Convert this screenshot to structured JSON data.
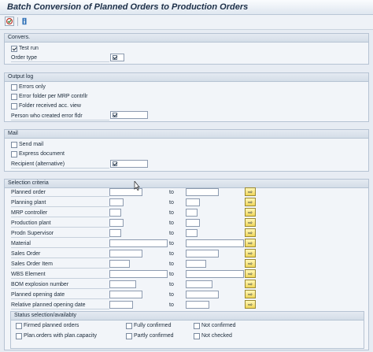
{
  "window": {
    "title": "Batch Conversion of Planned Orders to Production Orders"
  },
  "toolbar": {
    "buttons": [
      {
        "icon": "execute-icon"
      },
      {
        "icon": "info-icon"
      }
    ]
  },
  "conversion": {
    "title": "Convers.",
    "test_run_label": "Test run",
    "test_run_checked": true,
    "order_type_label": "Order type"
  },
  "output_log": {
    "title": "Output log",
    "errors_only_label": "Errors only",
    "error_folder_label": "Error folder per MRP contrllr",
    "folder_received_label": "Folder received acc. view",
    "person_created_label": "Person who created error fldr"
  },
  "mail": {
    "title": "Mail",
    "send_mail_label": "Send mail",
    "express_label": "Express document",
    "recipient_label": "Recipient (alternative)"
  },
  "selection": {
    "title": "Selection criteria",
    "to_label": "to",
    "rows": [
      {
        "label": "Planned order"
      },
      {
        "label": "Planning plant"
      },
      {
        "label": "MRP controller"
      },
      {
        "label": "Production plant"
      },
      {
        "label": "Prodn Supervisor"
      },
      {
        "label": "Material"
      },
      {
        "label": "Sales Order"
      },
      {
        "label": "Sales Order Item"
      },
      {
        "label": "WBS Element"
      },
      {
        "label": "BOM explosion number"
      },
      {
        "label": "Planned opening date"
      },
      {
        "label": "Relative planned opening date"
      }
    ]
  },
  "status": {
    "title": "Status selection/availabty",
    "options": [
      {
        "label": "Firmed planned orders"
      },
      {
        "label": "Fully confirmed"
      },
      {
        "label": "Not confirmed"
      },
      {
        "label": "Plan.orders with plan.capacity"
      },
      {
        "label": "Partly confirmed"
      },
      {
        "label": "Not checked"
      }
    ]
  }
}
